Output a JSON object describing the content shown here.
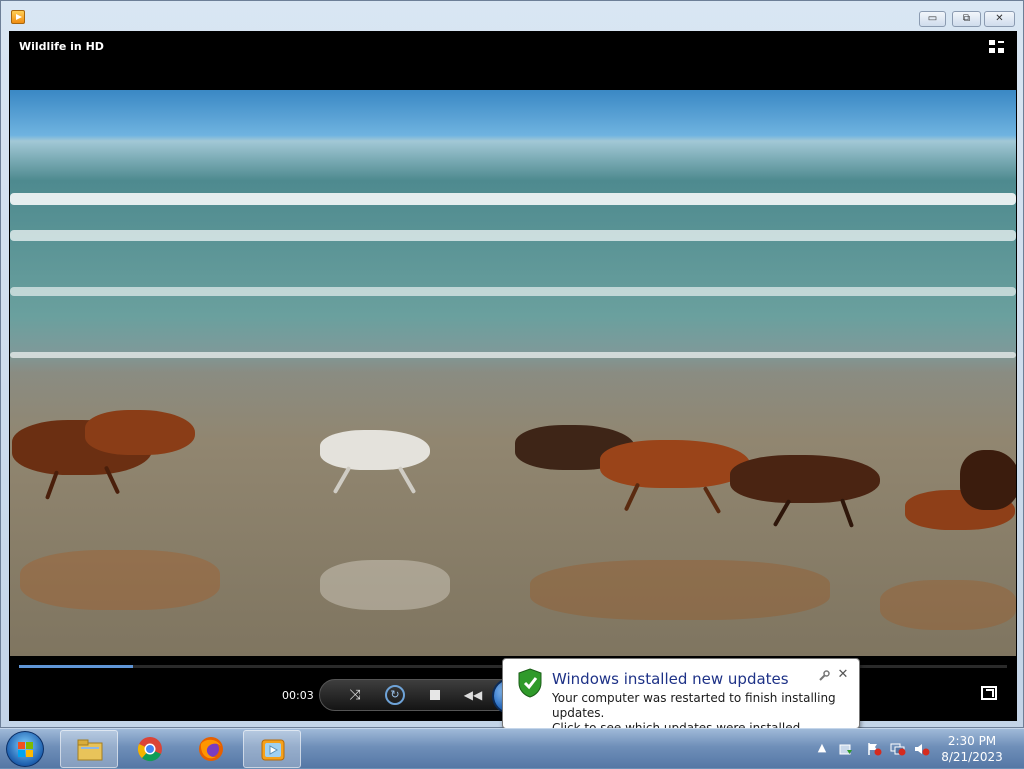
{
  "window": {
    "minimize_label": "▭",
    "maximize_label": "⧉",
    "close_label": "✕"
  },
  "player": {
    "video_title": "Wildlife in HD",
    "elapsed_time": "00:03",
    "seek_progress_fraction": 0.115,
    "controls": {
      "shuffle_label": "⤨",
      "repeat_label": "↻",
      "previous_label": "◀◀"
    }
  },
  "notification": {
    "title": "Windows installed new updates",
    "body_line1": "Your computer was restarted to finish installing updates.",
    "body_line2": "Click to see which updates were installed.",
    "options_icon": "wrench-icon",
    "close_label": "✕"
  },
  "taskbar": {
    "pinned": [
      {
        "name": "file-explorer",
        "active": true
      },
      {
        "name": "google-chrome",
        "active": false
      },
      {
        "name": "firefox",
        "active": false
      },
      {
        "name": "windows-media-player",
        "active": true
      }
    ],
    "tray": {
      "show_hidden_label": "▲",
      "time": "2:30 PM",
      "date": "8/21/2023"
    }
  },
  "colors": {
    "title_accent": "#1e3287",
    "seek_fill": "#5f95d6",
    "taskbar": "#5577a5"
  }
}
